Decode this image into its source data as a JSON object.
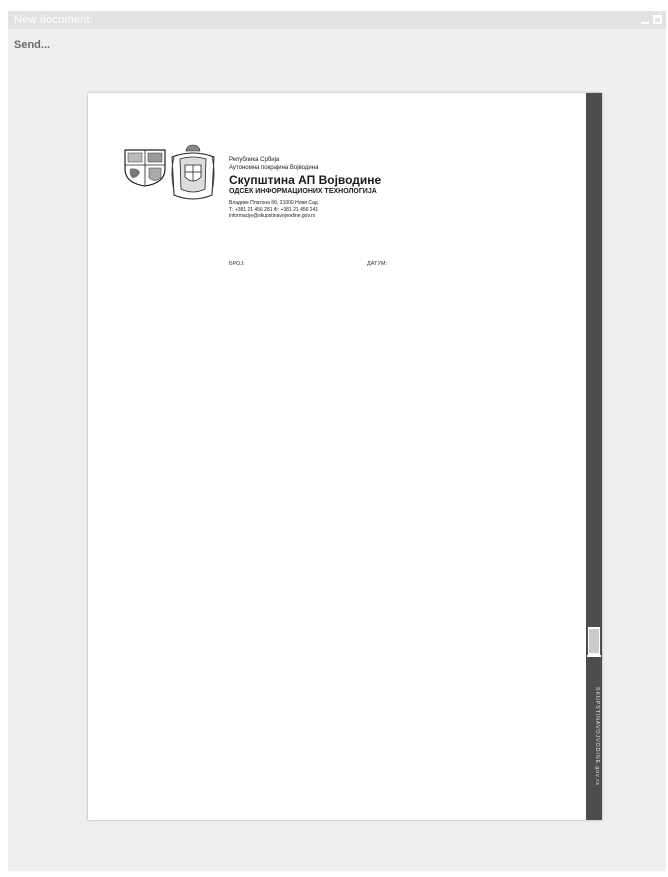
{
  "window": {
    "title": "New document:",
    "send_label": "Send..."
  },
  "letterhead": {
    "line1": "Република Србија",
    "line2": "Аутономна покрајина Војводина",
    "org_name": "Скупштина АП Војводине",
    "department": "ОДСЕК ИНФОРМАЦИОНИХ ТЕХНОЛОГИЈА",
    "address": "Владике Платона бб, 21000 Нови Сад",
    "phone_fax": "Т: +381 21 456 281 Ф: +381 21 456 241",
    "email": "informacije@skupstinavojvodine.gov.rs",
    "broj_label": "БРОЈ:",
    "datum_label": "ДАТУМ:",
    "side_text": "SKUPSTINAVOJVODINE.gov.rs"
  },
  "colors": {
    "window_bg": "#efefef",
    "titlebar_bg": "#e2e2e2",
    "side_strip": "#4d4d4f"
  }
}
